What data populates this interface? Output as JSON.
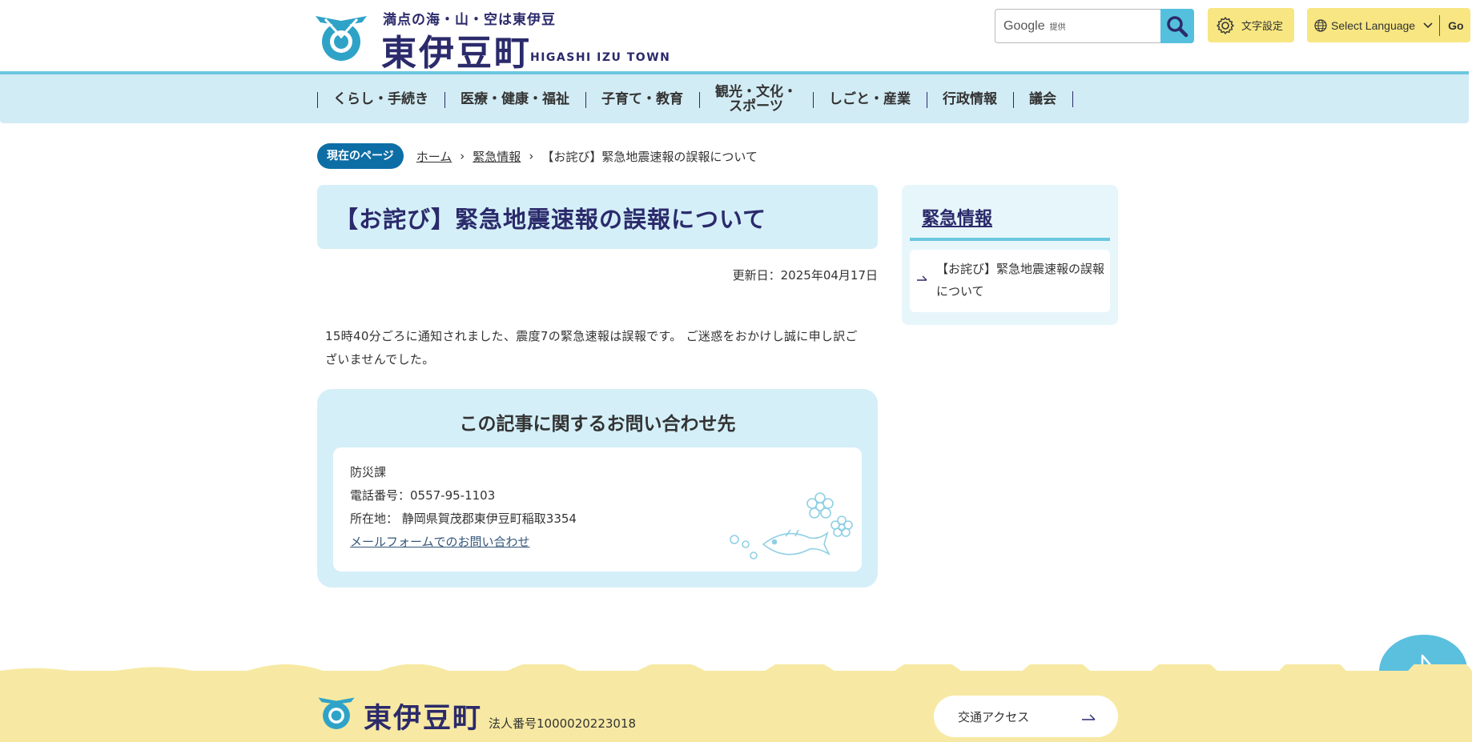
{
  "header": {
    "tagline": "満点の海・山・空は東伊豆",
    "town_name": "東伊豆町",
    "town_name_en": "HIGASHI IZU TOWN",
    "search": {
      "brand": "Google",
      "provided": "提供"
    },
    "text_size_label": "文字設定",
    "language_label": "Select Language",
    "go_label": "Go"
  },
  "nav": {
    "items": [
      {
        "label": "くらし・手続き"
      },
      {
        "label": "医療・健康・福祉"
      },
      {
        "label": "子育て・教育"
      },
      {
        "label": "観光・文化・\nスポーツ"
      },
      {
        "label": "しごと・産業"
      },
      {
        "label": "行政情報"
      },
      {
        "label": "議会"
      }
    ]
  },
  "breadcrumb": {
    "badge": "現在のページ",
    "home": "ホーム",
    "section": "緊急情報",
    "current": "【お詫び】緊急地震速報の誤報について"
  },
  "main": {
    "title": "【お詫び】緊急地震速報の誤報について",
    "updated": "更新日：2025年04月17日",
    "body": "15時40分ごろに通知されました、震度7の緊急速報は誤報です。 ご迷惑をおかけし誠に申し訳ございませんでした。"
  },
  "contact": {
    "title": "この記事に関するお問い合わせ先",
    "department": "防災課",
    "phone": "電話番号：0557-95-1103",
    "address": "所在地： 静岡県賀茂郡東伊豆町稲取3354",
    "mail_link": "メールフォームでのお問い合わせ"
  },
  "sidebar": {
    "title": "緊急情報",
    "link": "【お詫び】緊急地震速報の誤報について"
  },
  "footer": {
    "town_name": "東伊豆町",
    "corporate_number": "法人番号1000020223018",
    "access_label": "交通アクセス"
  },
  "colors": {
    "navy": "#2b2a6b",
    "light_blue": "#d4eff8",
    "accent_blue": "#5bc0de",
    "badge_blue": "#0d6ea6",
    "yellow": "#f7e682",
    "footer_yellow": "#f7e9a3"
  }
}
